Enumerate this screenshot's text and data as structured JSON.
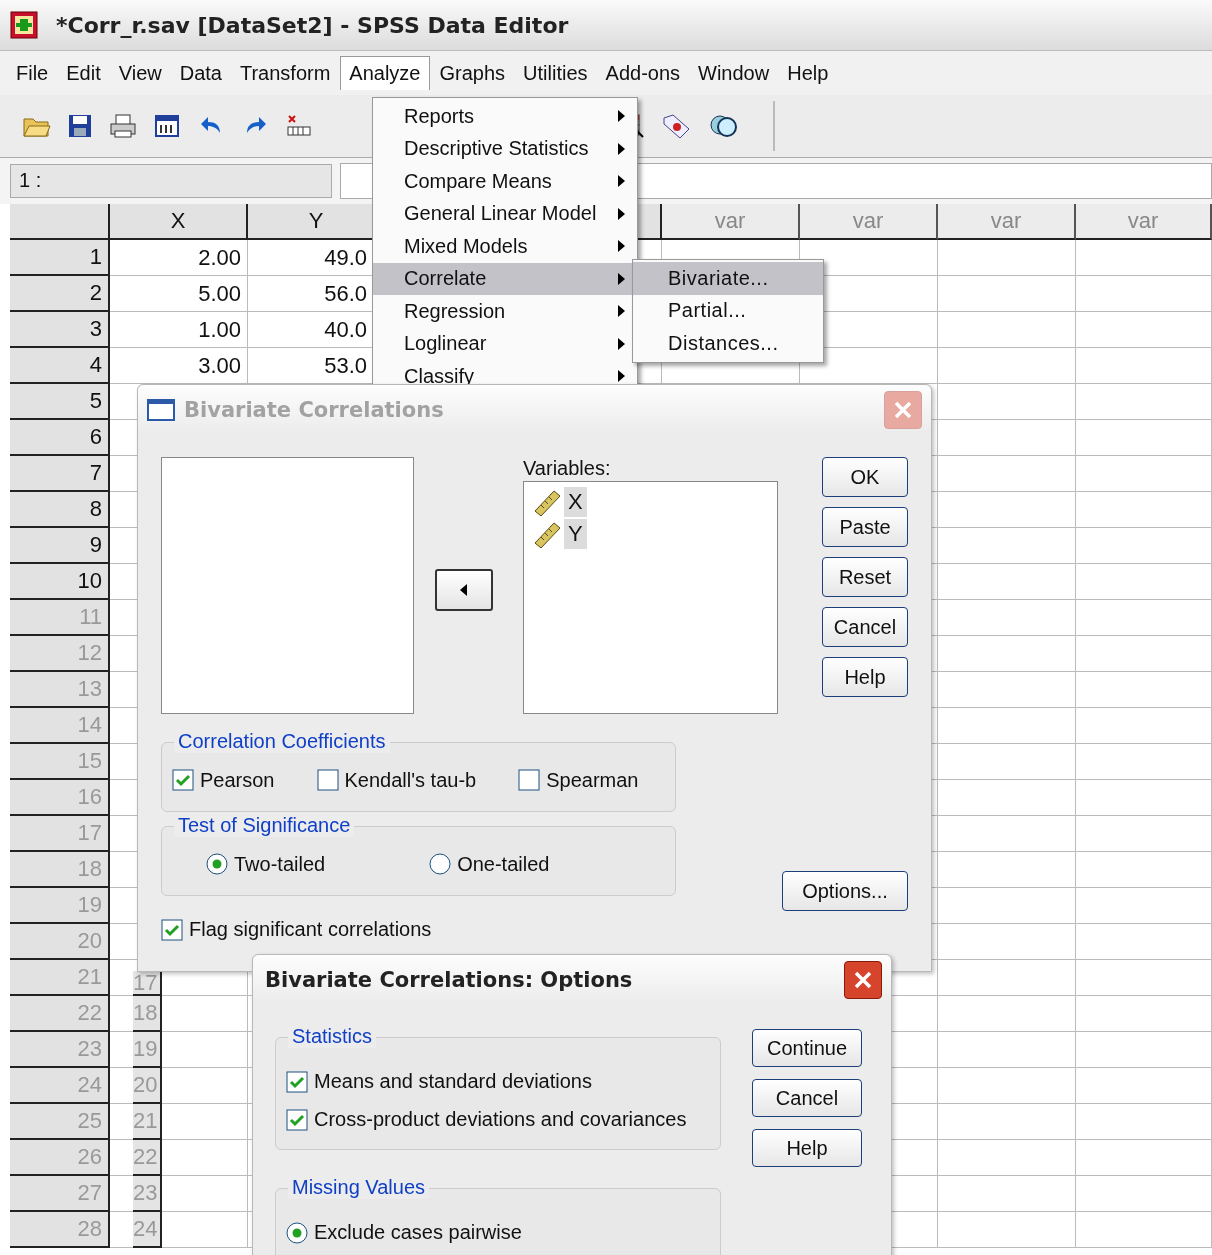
{
  "window": {
    "title": "*Corr_r.sav [DataSet2] - SPSS Data Editor"
  },
  "menu_bar": [
    {
      "label": "File",
      "selected": false
    },
    {
      "label": "Edit",
      "selected": false
    },
    {
      "label": "View",
      "selected": false
    },
    {
      "label": "Data",
      "selected": false
    },
    {
      "label": "Transform",
      "selected": false
    },
    {
      "label": "Analyze",
      "selected": true
    },
    {
      "label": "Graphs",
      "selected": false
    },
    {
      "label": "Utilities",
      "selected": false
    },
    {
      "label": "Add-ons",
      "selected": false
    },
    {
      "label": "Window",
      "selected": false
    },
    {
      "label": "Help",
      "selected": false
    }
  ],
  "cell_reference": {
    "label": "1 :"
  },
  "grid": {
    "columns": [
      "X",
      "Y"
    ],
    "var_columns": [
      "var",
      "var",
      "var",
      "var"
    ],
    "rows": [
      {
        "number": "1",
        "cells": [
          "2.00",
          "49.0"
        ],
        "dimmed": false
      },
      {
        "number": "2",
        "cells": [
          "5.00",
          "56.0"
        ],
        "dimmed": false
      },
      {
        "number": "3",
        "cells": [
          "1.00",
          "40.0"
        ],
        "dimmed": false
      },
      {
        "number": "4",
        "cells": [
          "3.00",
          "53.0"
        ],
        "dimmed": false
      },
      {
        "number": "5",
        "dimmed": false
      },
      {
        "number": "6",
        "dimmed": false
      },
      {
        "number": "7",
        "dimmed": false
      },
      {
        "number": "8",
        "dimmed": false
      },
      {
        "number": "9",
        "dimmed": false
      },
      {
        "number": "10",
        "dimmed": false
      },
      {
        "number": "11",
        "dimmed": true
      },
      {
        "number": "12",
        "dimmed": true
      },
      {
        "number": "13",
        "dimmed": true
      },
      {
        "number": "14",
        "dimmed": true
      },
      {
        "number": "15",
        "dimmed": true
      },
      {
        "number": "16",
        "dimmed": true
      },
      {
        "number": "17",
        "dimmed": true
      },
      {
        "number": "18",
        "dimmed": true
      },
      {
        "number": "19",
        "dimmed": true
      },
      {
        "number": "20",
        "dimmed": true
      },
      {
        "number": "21",
        "dimmed": true
      },
      {
        "number": "22",
        "dimmed": true
      },
      {
        "number": "23",
        "dimmed": true
      },
      {
        "number": "24",
        "dimmed": true
      },
      {
        "number": "25",
        "dimmed": true
      },
      {
        "number": "26",
        "dimmed": true
      },
      {
        "number": "27",
        "dimmed": true
      },
      {
        "number": "28",
        "dimmed": true
      }
    ]
  },
  "background_row_numbers": [
    "17",
    "18",
    "19",
    "20",
    "21",
    "22",
    "23",
    "24"
  ],
  "analyze_menu": {
    "items": [
      {
        "label": "Reports",
        "selected": false
      },
      {
        "label": "Descriptive Statistics",
        "selected": false
      },
      {
        "label": "Compare Means",
        "selected": false
      },
      {
        "label": "General Linear Model",
        "selected": false
      },
      {
        "label": "Mixed Models",
        "selected": false
      },
      {
        "label": "Correlate",
        "selected": true
      },
      {
        "label": "Regression",
        "selected": false
      },
      {
        "label": "Loglinear",
        "selected": false
      },
      {
        "label": "Classify",
        "selected": false
      }
    ]
  },
  "correlate_submenu": {
    "items": [
      {
        "label": "Bivariate...",
        "selected": true
      },
      {
        "label": "Partial...",
        "selected": false
      },
      {
        "label": "Distances...",
        "selected": false
      }
    ]
  },
  "bivariate_dialog": {
    "title": "Bivariate Correlations",
    "active": false,
    "variables_label": "Variables:",
    "variables": [
      "X",
      "Y"
    ],
    "buttons": [
      "OK",
      "Paste",
      "Reset",
      "Cancel",
      "Help"
    ],
    "coefficients": {
      "legend": "Correlation Coefficients",
      "options": [
        {
          "label": "Pearson",
          "checked": true
        },
        {
          "label": "Kendall's tau-b",
          "checked": false
        },
        {
          "label": "Spearman",
          "checked": false
        }
      ]
    },
    "significance": {
      "legend": "Test of Significance",
      "options": [
        {
          "label": "Two-tailed",
          "selected": true
        },
        {
          "label": "One-tailed",
          "selected": false
        }
      ]
    },
    "flag": {
      "label": "Flag significant correlations",
      "checked": true
    },
    "options_button": "Options..."
  },
  "options_dialog": {
    "title": "Bivariate Correlations: Options",
    "active": true,
    "statistics": {
      "legend": "Statistics",
      "options": [
        {
          "label": "Means and standard deviations",
          "checked": true
        },
        {
          "label": "Cross-product deviations and covariances",
          "checked": true
        }
      ]
    },
    "buttons": [
      "Continue",
      "Cancel",
      "Help"
    ],
    "missing_values": {
      "legend": "Missing Values",
      "options": [
        {
          "label": "Exclude cases pairwise",
          "selected": true
        }
      ]
    }
  }
}
